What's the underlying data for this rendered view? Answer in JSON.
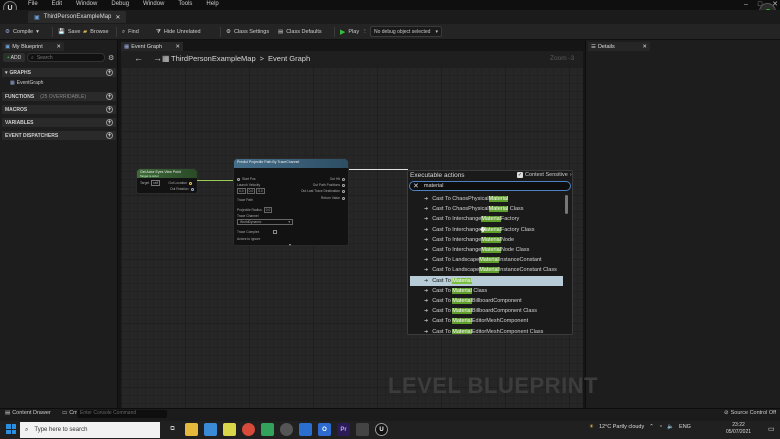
{
  "menu": [
    "File",
    "Edit",
    "Window",
    "Debug",
    "Window",
    "Tools",
    "Help"
  ],
  "document_tab": "ThirdPersonExampleMap",
  "toolbar": {
    "compile": "Compile",
    "save": "Save",
    "browse": "Browse",
    "find": "Find",
    "hide_unrelated": "Hide Unrelated",
    "class_settings": "Class Settings",
    "class_defaults": "Class Defaults",
    "play": "Play",
    "debug_object": "No debug object selected"
  },
  "left_panel": {
    "tab": "My Blueprint",
    "add": "ADD",
    "search_placeholder": "Search",
    "sections": {
      "graphs": "GRAPHS",
      "functions": "FUNCTIONS",
      "functions_sub": "(25 OVERRIDABLE)",
      "macros": "MACROS",
      "variables": "VARIABLES",
      "dispatchers": "EVENT DISPATCHERS"
    },
    "graph_item": "EventGraph"
  },
  "graph": {
    "tab": "Event Graph",
    "breadcrumb_root": "ThirdPersonExampleMap",
    "breadcrumb_sep": ">",
    "breadcrumb_leaf": "Event Graph",
    "zoom": "Zoom -3",
    "watermark": "LEVEL BLUEPRINT"
  },
  "node_get": {
    "title": "Get Actor Eyes View Point",
    "subtitle": "Target is Actor",
    "target": "Target",
    "target_value": "self",
    "out1": "Out Location",
    "out2": "Out Rotation"
  },
  "node_proj": {
    "title": "Predict Projectile Path By TraceChannel",
    "pins_left": [
      "Start Pos",
      "Launch Velocity",
      "Trace Path",
      "Projectile Radius",
      "Trace Channel",
      "Trace Complex"
    ],
    "launch_values": [
      "0.0",
      "0.0",
      "0.0"
    ],
    "radius_value": "0.0",
    "channel_value": "WorldDynamic",
    "pins_right": [
      "Out Hit",
      "Out Path Positions",
      "Out Last Trace Destination",
      "Return Value"
    ],
    "actors_ignore": "Actors to Ignore"
  },
  "popup": {
    "title": "Executable actions",
    "context": "Context Sensitive",
    "query": "material",
    "results": [
      {
        "pre": "Cast To ChaosPhysical",
        "hl": "Material",
        "post": "",
        "sel": false
      },
      {
        "pre": "Cast To ChaosPhysical",
        "hl": "Material",
        "post": " Class",
        "sel": false
      },
      {
        "pre": "Cast To Interchange",
        "hl": "Material",
        "post": "Factory",
        "sel": false
      },
      {
        "pre": "Cast To Interchange",
        "hl": "Material",
        "post": "Factory Class",
        "sel": false
      },
      {
        "pre": "Cast To Interchange",
        "hl": "Material",
        "post": "Node",
        "sel": false
      },
      {
        "pre": "Cast To Interchange",
        "hl": "Material",
        "post": "Node Class",
        "sel": false
      },
      {
        "pre": "Cast To Landscape",
        "hl": "Material",
        "post": "InstanceConstant",
        "sel": false
      },
      {
        "pre": "Cast To Landscape",
        "hl": "Material",
        "post": "InstanceConstant Class",
        "sel": false
      },
      {
        "pre": "Cast To ",
        "hl": "Material",
        "post": "",
        "sel": true
      },
      {
        "pre": "Cast To ",
        "hl": "Material",
        "post": " Class",
        "sel": false
      },
      {
        "pre": "Cast To ",
        "hl": "Material",
        "post": "BillboardComponent",
        "sel": false
      },
      {
        "pre": "Cast To ",
        "hl": "Material",
        "post": "BillboardComponent Class",
        "sel": false
      },
      {
        "pre": "Cast To ",
        "hl": "Material",
        "post": "EditorMeshComponent",
        "sel": false
      },
      {
        "pre": "Cast To ",
        "hl": "Material",
        "post": "EditorMeshComponent Class",
        "sel": false
      }
    ]
  },
  "details": {
    "tab": "Details"
  },
  "statusbar": {
    "content_drawer": "Content Drawer",
    "cmd": "Cmd",
    "cmd_placeholder": "Enter Console Command",
    "source_control": "Source Control Off"
  },
  "taskbar": {
    "search": "Type here to search",
    "weather": "12°C  Partly cloudy",
    "language": "ENG",
    "time": "23:22",
    "date": "05/07/2021"
  }
}
